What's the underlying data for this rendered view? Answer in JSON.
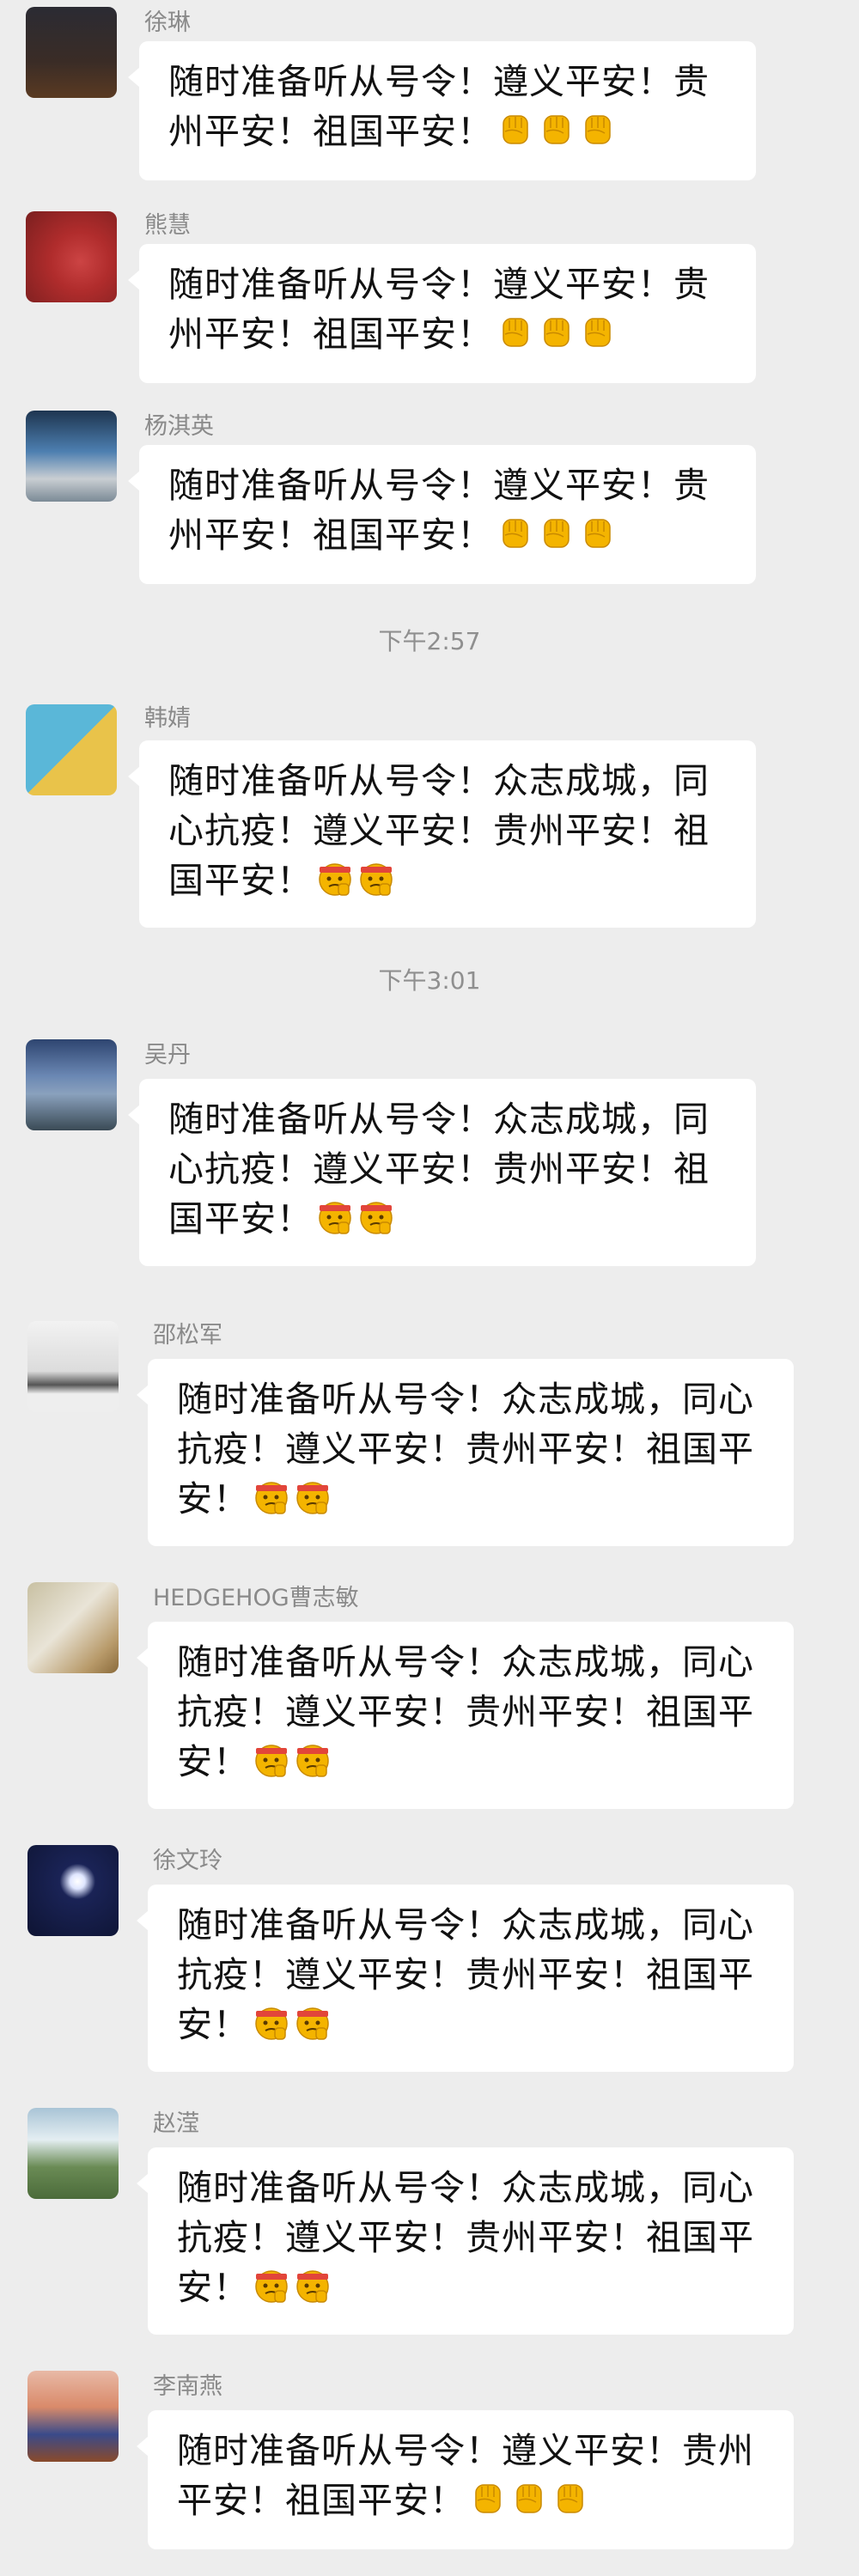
{
  "messages": [
    {
      "sender": "徐琳",
      "text": "随时准备听从号令！遵义平安！贵州平安！祖国平安！",
      "emoji": "fist-icon"
    },
    {
      "sender": "熊慧",
      "text": "随时准备听从号令！遵义平安！贵州平安！祖国平安！",
      "emoji": "fist-icon"
    },
    {
      "sender": "杨淇英",
      "text": "随时准备听从号令！遵义平安！贵州平安！祖国平安！",
      "emoji": "fist-icon"
    },
    {
      "sender": "韩婧",
      "text": "随时准备听从号令！众志成城，同心抗疫！遵义平安！贵州平安！祖国平安！",
      "emoji": "fighting-face-icon"
    },
    {
      "sender": "吴丹",
      "text": "随时准备听从号令！众志成城，同心抗疫！遵义平安！贵州平安！祖国平安！",
      "emoji": "fighting-face-icon"
    },
    {
      "sender": "邵松军",
      "text": "随时准备听从号令！众志成城，同心抗疫！遵义平安！贵州平安！祖国平安！",
      "emoji": "fighting-face-icon"
    },
    {
      "sender": "HEDGEHOG曹志敏",
      "text": "随时准备听从号令！众志成城，同心抗疫！遵义平安！贵州平安！祖国平安！",
      "emoji": "fighting-face-icon"
    },
    {
      "sender": "徐文玲",
      "text": "随时准备听从号令！众志成城，同心抗疫！遵义平安！贵州平安！祖国平安！",
      "emoji": "fighting-face-icon"
    },
    {
      "sender": "赵滢",
      "text": "随时准备听从号令！众志成城，同心抗疫！遵义平安！贵州平安！祖国平安！",
      "emoji": "fighting-face-icon"
    },
    {
      "sender": "李南燕",
      "text": "随时准备听从号令！遵义平安！贵州平安！祖国平安！",
      "emoji": "fist-icon"
    }
  ],
  "timestamps": [
    "下午2:57",
    "下午3:01"
  ],
  "colors": {
    "background": "#ededed",
    "bubble": "#ffffff",
    "name": "#8a8a8a",
    "emoji": "#f4b400"
  }
}
